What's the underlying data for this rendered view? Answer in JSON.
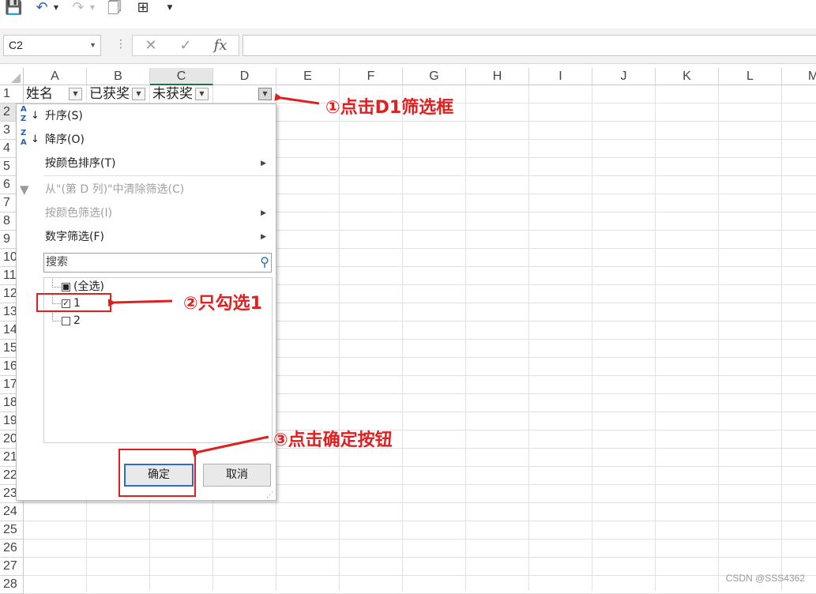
{
  "name_box": "C2",
  "formula_icons": {
    "cancel": "✕",
    "enter": "✓",
    "fx": "fx"
  },
  "columns": [
    "A",
    "B",
    "C",
    "D",
    "E",
    "F",
    "G",
    "H",
    "I",
    "J",
    "K",
    "L",
    "M"
  ],
  "rows": [
    "1",
    "2",
    "3",
    "4",
    "5",
    "6",
    "7",
    "8",
    "9",
    "10",
    "11",
    "12",
    "13",
    "14",
    "15",
    "16",
    "17",
    "18",
    "19",
    "20",
    "21",
    "22",
    "23",
    "24",
    "25",
    "26",
    "27",
    "28"
  ],
  "header_cells": [
    "姓名",
    "已获奖",
    "未获奖"
  ],
  "filter_menu": {
    "sort_asc": "升序(S)",
    "sort_desc": "降序(O)",
    "sort_by_color": "按颜色排序(T)",
    "clear_filter": "从\"(第 D 列)\"中清除筛选(C)",
    "filter_by_color": "按颜色筛选(I)",
    "number_filter": "数字筛选(F)",
    "search_placeholder": "搜索",
    "list_items": [
      "(全选)",
      "1",
      "2"
    ],
    "ok": "确定",
    "cancel": "取消"
  },
  "annotations": {
    "step1": "①点击D1筛选框",
    "step2": "②只勾选1",
    "step3": "③点击确定按钮"
  },
  "watermark": "CSDN @SSS4362",
  "colors": {
    "annotation": "#e02020",
    "ok_border": "#2d6cc0"
  }
}
